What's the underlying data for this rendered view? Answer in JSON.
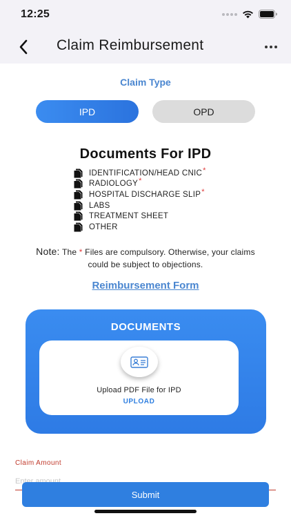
{
  "status_bar": {
    "time": "12:25"
  },
  "header": {
    "title": "Claim Reimbursement"
  },
  "claim_type": {
    "label": "Claim Type",
    "options": [
      {
        "label": "IPD",
        "selected": true
      },
      {
        "label": "OPD",
        "selected": false
      }
    ]
  },
  "documents": {
    "heading": "Documents For IPD",
    "items": [
      {
        "label": "IDENTIFICATION/HEAD CNIC",
        "required_mark": "*"
      },
      {
        "label": "RADIOLOGY",
        "required_mark": "*"
      },
      {
        "label": "HOSPITAL DISCHARGE SLIP",
        "required_mark": "*"
      },
      {
        "label": "LABS",
        "required_mark": ""
      },
      {
        "label": "TREATMENT SHEET",
        "required_mark": ""
      },
      {
        "label": "OTHER",
        "required_mark": ""
      }
    ]
  },
  "note": {
    "label": "Note:",
    "before": " The ",
    "asterisk": "*",
    "after": " Files are compulsory. Otherwise, your claims could be subject to objections."
  },
  "form_link": "Reimbursement Form",
  "upload_card": {
    "title": "DOCUMENTS",
    "caption": "Upload PDF File for IPD",
    "action": "UPLOAD"
  },
  "claim_amount": {
    "label": "Claim Amount",
    "placeholder": "Enter amount",
    "value": ""
  },
  "submit_label": "Submit",
  "colors": {
    "accent": "#2f7fe0",
    "link": "#4a86d0",
    "required": "#e03a3a",
    "field_label": "#c0392b"
  },
  "icons": {
    "back": "chevron-left-icon",
    "more": "more-horizontal-icon",
    "file": "file-copy-icon",
    "upload": "id-card-icon"
  }
}
